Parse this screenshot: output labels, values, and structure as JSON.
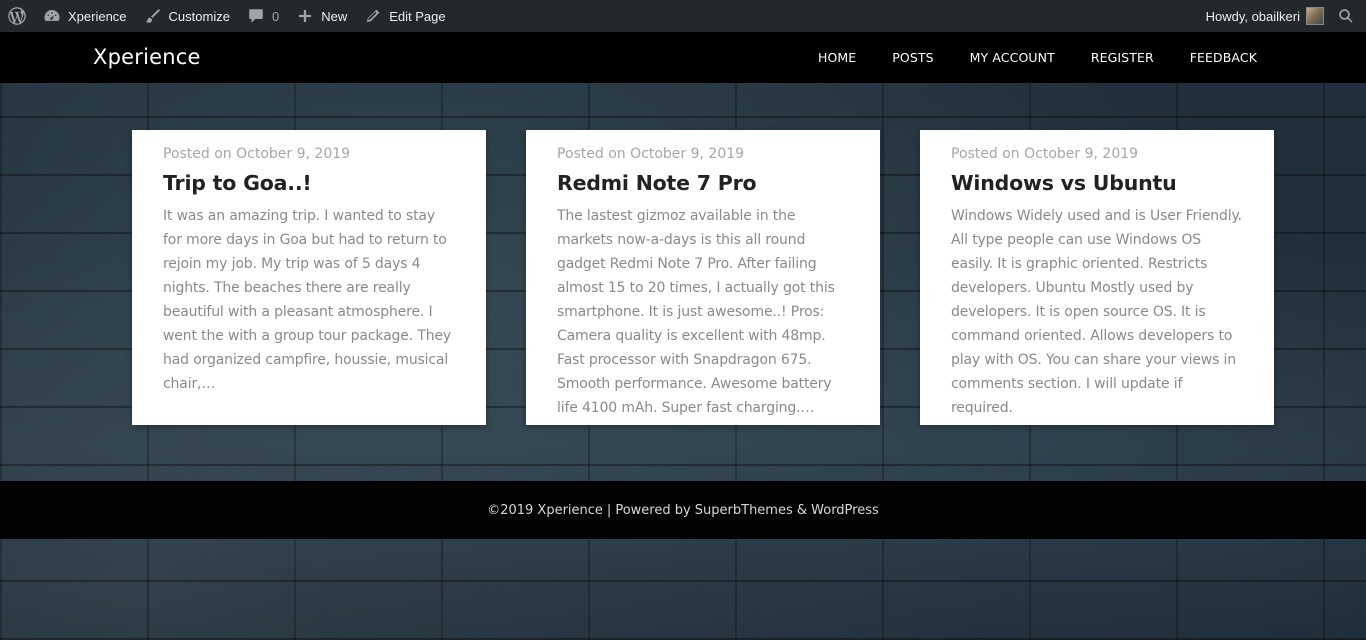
{
  "adminbar": {
    "site_name": "Xperience",
    "customize": "Customize",
    "comments_count": "0",
    "new": "New",
    "edit_page": "Edit Page",
    "howdy": "Howdy, obailkeri"
  },
  "header": {
    "site_title": "Xperience",
    "nav": [
      "HOME",
      "POSTS",
      "MY ACCOUNT",
      "REGISTER",
      "FEEDBACK"
    ]
  },
  "posts": [
    {
      "date": "Posted on October 9, 2019",
      "title": "Trip to Goa..!",
      "excerpt": "It was an amazing trip. I wanted to stay for more days in Goa but had to return to rejoin my job. My trip was of 5 days 4 nights. The beaches there are really beautiful with a pleasant atmosphere. I went the with a group tour package. They had organized campfire, houssie, musical chair,…"
    },
    {
      "date": "Posted on October 9, 2019",
      "title": "Redmi Note 7 Pro",
      "excerpt": "The lastest gizmoz available in the markets now-a-days is this all round gadget Redmi Note 7 Pro. After failing almost 15 to 20 times, I actually got this smartphone. It is just awesome..! Pros: Camera quality is excellent with 48mp. Fast processor with Snapdragon 675. Smooth performance. Awesome battery life 4100 mAh. Super fast charging.…"
    },
    {
      "date": "Posted on October 9, 2019",
      "title": "Windows vs Ubuntu",
      "excerpt": "Windows Widely used and is User Friendly. All type people can use Windows OS easily. It is graphic oriented. Restricts developers. Ubuntu Mostly used by developers. It is open source OS. It is command oriented. Allows developers to play with OS. You can share your views in comments section. I will update if required."
    }
  ],
  "footer": {
    "copyright": "©2019 Xperience",
    "separator": "|",
    "powered_by": "Powered by SuperbThemes & WordPress"
  }
}
